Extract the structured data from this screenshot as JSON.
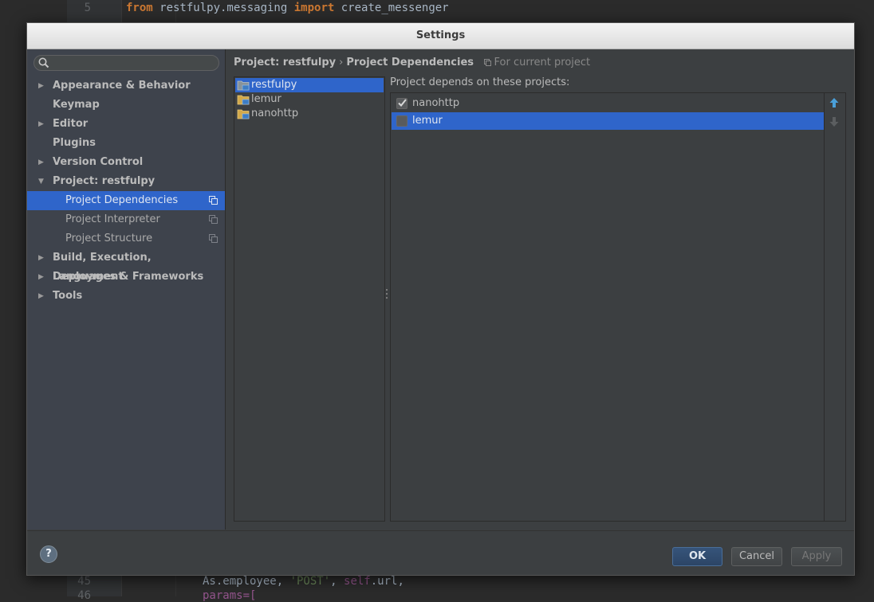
{
  "editor": {
    "top_line": {
      "number": "5",
      "kw1": "from",
      "module": " restfulpy.messaging ",
      "kw2": "import",
      "name": " create_messenger"
    },
    "bottom_line": {
      "number": "45",
      "before": "As.employee, ",
      "str": "'POST'",
      "mid": ", ",
      "self": "self",
      "after": ".url,"
    },
    "bottom_line2": {
      "number": "46",
      "text": "params=["
    }
  },
  "dialog": {
    "title": "Settings",
    "search": {
      "placeholder": ""
    },
    "sidebar": {
      "items": [
        {
          "label": "Appearance & Behavior",
          "expandable": true
        },
        {
          "label": "Keymap",
          "expandable": false
        },
        {
          "label": "Editor",
          "expandable": true
        },
        {
          "label": "Plugins",
          "expandable": false
        },
        {
          "label": "Version Control",
          "expandable": true
        },
        {
          "label": "Project: restfulpy",
          "expandable": true,
          "expanded": true
        },
        {
          "label": "Build, Execution, Deployment",
          "expandable": true
        },
        {
          "label": "Languages & Frameworks",
          "expandable": true
        },
        {
          "label": "Tools",
          "expandable": true
        }
      ],
      "subitems": [
        {
          "label": "Project Dependencies",
          "selected": true
        },
        {
          "label": "Project Interpreter",
          "selected": false
        },
        {
          "label": "Project Structure",
          "selected": false
        }
      ]
    },
    "breadcrumb": {
      "parent": "Project: restfulpy",
      "separator": "›",
      "current": "Project Dependencies",
      "scope": "For current project"
    },
    "projects": [
      {
        "label": "restfulpy",
        "selected": true
      },
      {
        "label": "lemur",
        "selected": false
      },
      {
        "label": "nanohttp",
        "selected": false
      }
    ],
    "depends_label": "Project depends on these projects:",
    "dependencies": [
      {
        "label": "nanohttp",
        "checked": true,
        "selected": false
      },
      {
        "label": "lemur",
        "checked": false,
        "selected": true
      }
    ],
    "buttons": {
      "help": "?",
      "ok": "OK",
      "cancel": "Cancel",
      "apply": "Apply"
    },
    "colors": {
      "selection": "#2f65ca",
      "sidebar_bg": "#3e434c",
      "panel_bg": "#3c3f41",
      "move_up_arrow": "#4a9fd8"
    }
  }
}
